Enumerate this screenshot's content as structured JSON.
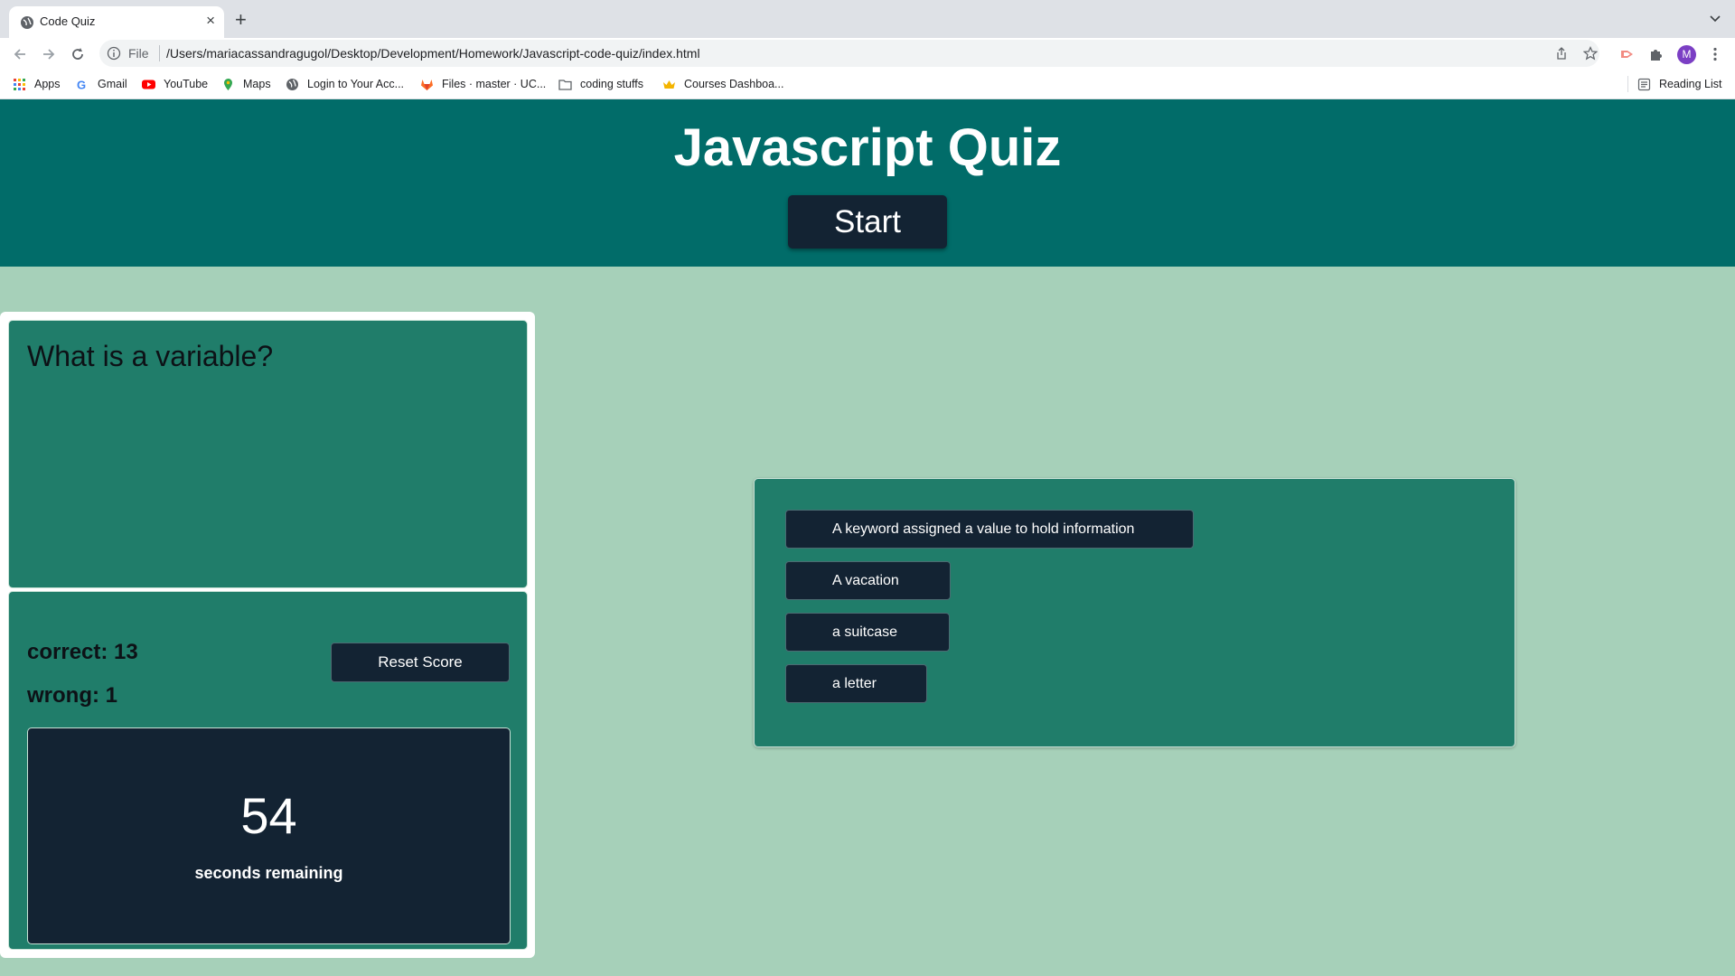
{
  "browser": {
    "tab_title": "Code Quiz",
    "tab_close": "×",
    "new_tab": "+",
    "url_scheme": "File",
    "url": "/Users/mariacassandragugol/Desktop/Development/Homework/Javascript-code-quiz/index.html",
    "avatar_letter": "M",
    "bookmarks": [
      {
        "label": "Apps",
        "icon": "apps-grid-icon"
      },
      {
        "label": "Gmail",
        "icon": "google-icon"
      },
      {
        "label": "YouTube",
        "icon": "youtube-icon"
      },
      {
        "label": "Maps",
        "icon": "maps-pin-icon"
      },
      {
        "label": "Login to Your Acc...",
        "icon": "globe-icon"
      },
      {
        "label": "Files · master · UC...",
        "icon": "gitlab-icon"
      },
      {
        "label": "coding stuffs",
        "icon": "folder-icon"
      },
      {
        "label": "Courses Dashboa...",
        "icon": "crown-icon"
      }
    ],
    "reading_list": "Reading List"
  },
  "header": {
    "title": "Javascript Quiz",
    "start_label": "Start"
  },
  "question": {
    "text": "What is a variable?"
  },
  "score": {
    "correct": "correct: 13",
    "wrong": "wrong: 1",
    "reset_label": "Reset Score"
  },
  "timer": {
    "value": "54",
    "label": "seconds remaining"
  },
  "answers": [
    "A keyword assigned a value to hold information",
    "A vacation",
    "a suitcase",
    "a letter"
  ],
  "colors": {
    "header_bg": "#016c69",
    "page_bg": "#a6d0b9",
    "panel_bg": "#207d6a",
    "button_bg": "#132333"
  }
}
